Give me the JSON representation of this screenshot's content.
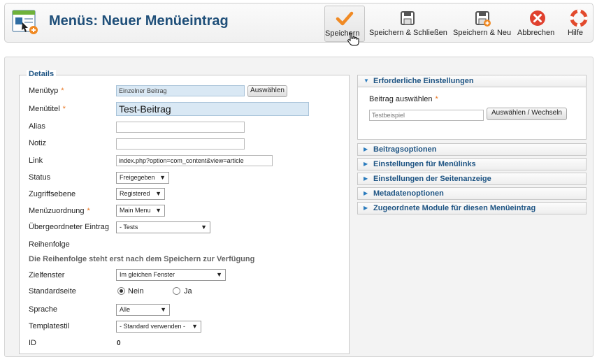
{
  "header": {
    "title": "Menüs: Neuer Menüeintrag",
    "buttons": {
      "save": "Speichern",
      "save_close": "Speichern & Schließen",
      "save_new": "Speichern & Neu",
      "cancel": "Abbrechen",
      "help": "Hilfe"
    }
  },
  "details": {
    "legend": "Details",
    "menutype": {
      "label": "Menütyp",
      "value": "Einzelner Beitrag",
      "select_label": "Auswählen"
    },
    "menutitle": {
      "label": "Menütitel",
      "value": "Test-Beitrag"
    },
    "alias": {
      "label": "Alias",
      "value": ""
    },
    "note": {
      "label": "Notiz",
      "value": ""
    },
    "link": {
      "label": "Link",
      "value": "index.php?option=com_content&view=article"
    },
    "status": {
      "label": "Status",
      "value": "Freigegeben"
    },
    "access": {
      "label": "Zugriffsebene",
      "value": "Registered"
    },
    "menu": {
      "label": "Menüzuordnung",
      "value": "Main Menu"
    },
    "parent": {
      "label": "Übergeordneter Eintrag",
      "value": "- Tests"
    },
    "ordering": {
      "label": "Reihenfolge",
      "note": "Die Reihenfolge steht erst nach dem Speichern zur Verfügung"
    },
    "target": {
      "label": "Zielfenster",
      "value": "Im gleichen Fenster"
    },
    "home": {
      "label": "Standardseite",
      "no": "Nein",
      "yes": "Ja",
      "selected": "no"
    },
    "language": {
      "label": "Sprache",
      "value": "Alle"
    },
    "template": {
      "label": "Templatestil",
      "value": "- Standard verwenden -"
    },
    "id": {
      "label": "ID",
      "value": "0"
    }
  },
  "sidebar": {
    "required": {
      "title": "Erforderliche Einstellungen",
      "article_label": "Beitrag auswählen",
      "article_value": "Testbeispiel",
      "button": "Auswählen / Wechseln"
    },
    "panels": [
      "Beitragsoptionen",
      "Einstellungen für Menülinks",
      "Einstellungen der Seitenanzeige",
      "Metadatenoptionen",
      "Zugeordnete Module für diesen Menüeintrag"
    ]
  },
  "colors": {
    "title": "#1f4f79",
    "accent": "#e8741f",
    "cancel": "#e0412f",
    "link": "#1f5584"
  }
}
